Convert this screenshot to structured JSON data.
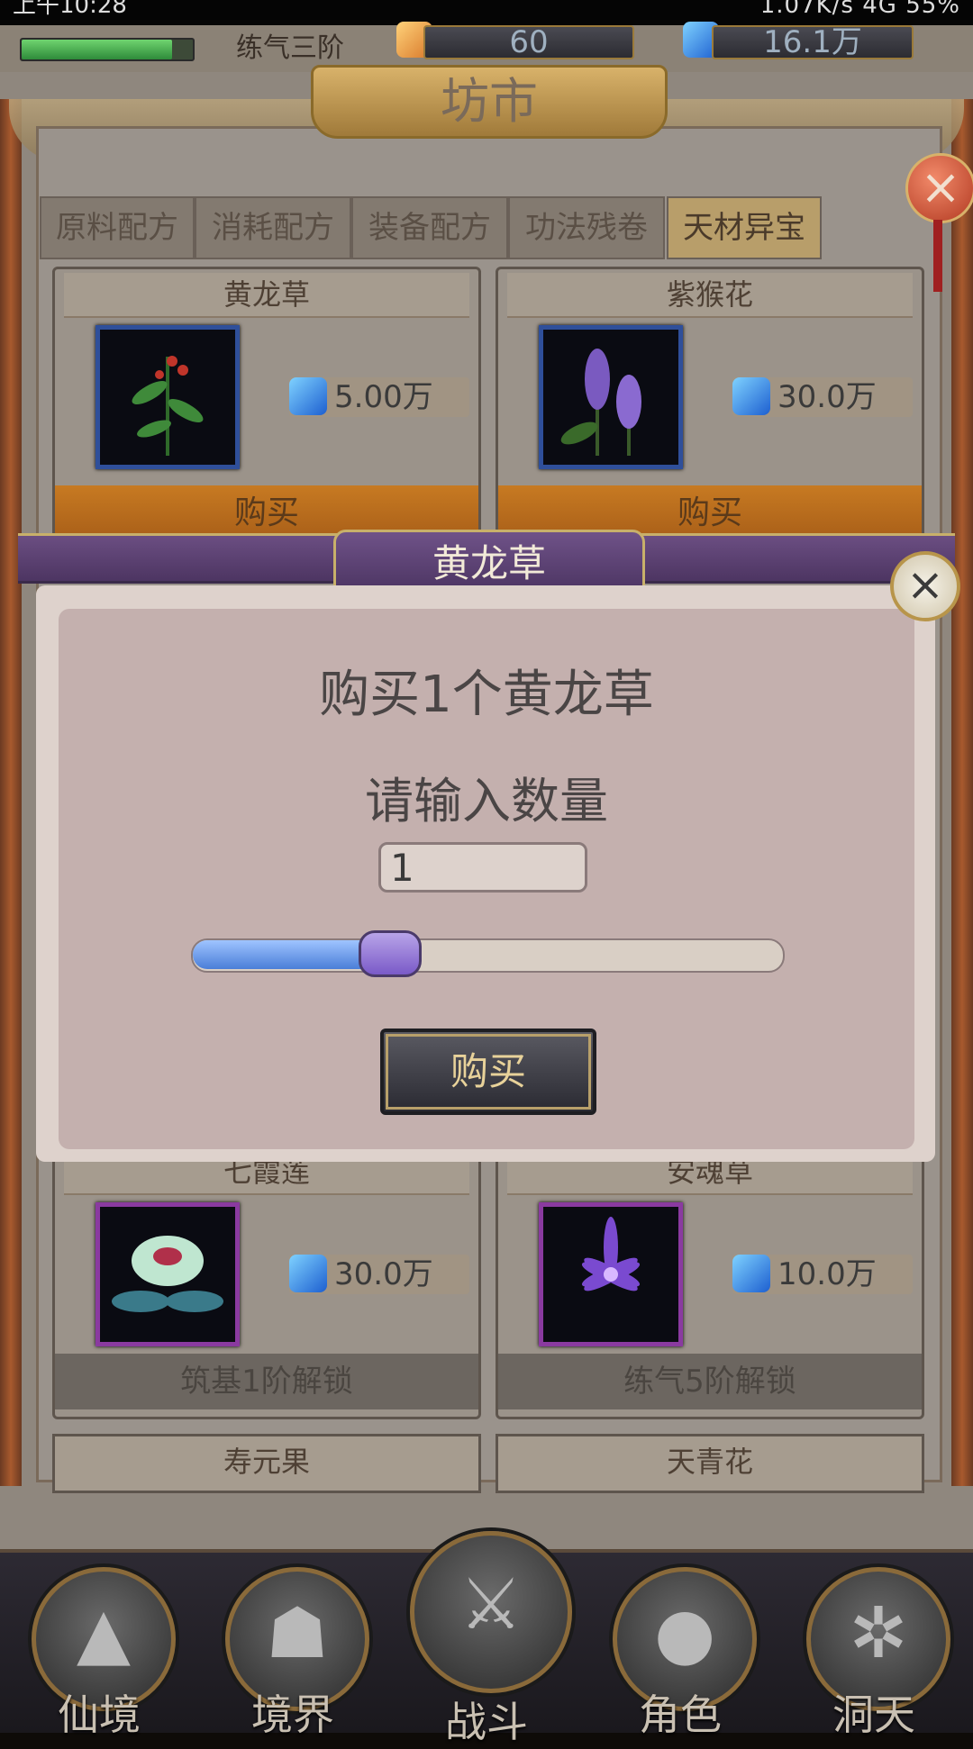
{
  "status_bar": {
    "time": "上午10:28",
    "right": "1.07K/s  4G  55%"
  },
  "topbar": {
    "realm": "练气三阶",
    "gold": "60",
    "gems": "16.1万"
  },
  "shop": {
    "title": "坊市"
  },
  "tabs": [
    {
      "label": "原料配方",
      "active": false
    },
    {
      "label": "消耗配方",
      "active": false
    },
    {
      "label": "装备配方",
      "active": false
    },
    {
      "label": "功法残卷",
      "active": false
    },
    {
      "label": "天材异宝",
      "active": true
    }
  ],
  "items": [
    {
      "name": "黄龙草",
      "price": "5.00万",
      "action": "购买",
      "icon": "yellow-dragon-herb-icon"
    },
    {
      "name": "紫猴花",
      "price": "30.0万",
      "action": "购买",
      "icon": "purple-flower-icon"
    },
    {
      "name": "七霞莲",
      "price": "30.0万",
      "action": "筑基1阶解锁",
      "icon": "lotus-icon"
    },
    {
      "name": "安魂草",
      "price": "10.0万",
      "action": "练气5阶解锁",
      "icon": "soul-grass-icon"
    },
    {
      "name": "寿元果",
      "price": "",
      "action": "",
      "icon": ""
    },
    {
      "name": "天青花",
      "price": "",
      "action": "",
      "icon": ""
    }
  ],
  "dialog": {
    "title": "黄龙草",
    "message": "购买1个黄龙草",
    "prompt": "请输入数量",
    "quantity": "1",
    "slider_fraction": 0.3,
    "confirm_label": "购买"
  },
  "nav": [
    {
      "label": "仙境",
      "icon": "mountain-icon"
    },
    {
      "label": "境界",
      "icon": "meditation-icon"
    },
    {
      "label": "战斗",
      "icon": "crossed-swords-icon"
    },
    {
      "label": "角色",
      "icon": "character-icon"
    },
    {
      "label": "洞天",
      "icon": "triple-swirl-icon"
    }
  ],
  "colors": {
    "dialog_purple": "#5a3f70",
    "buy_orange": "#c77a22",
    "accent_gold": "#c8b06a"
  }
}
